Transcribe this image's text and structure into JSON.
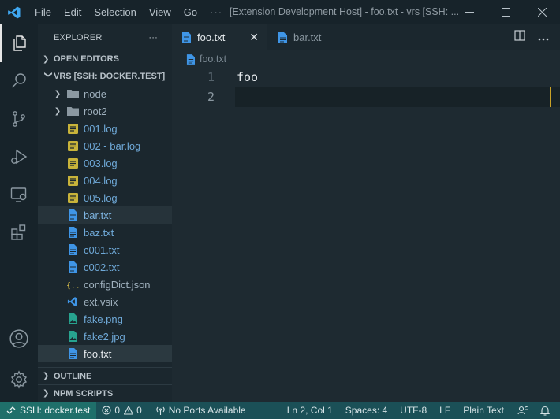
{
  "titlebar": {
    "menu": [
      "File",
      "Edit",
      "Selection",
      "View",
      "Go"
    ],
    "more": "···",
    "title": "[Extension Development Host] - foo.txt - vrs [SSH: ...",
    "brand_color": "#3fa7f0"
  },
  "activitybar": {
    "items": [
      "explorer-icon",
      "search-icon",
      "source-control-icon",
      "run-debug-icon",
      "remote-explorer-icon",
      "extensions-icon",
      "accounts-icon",
      "manage-gear-icon"
    ]
  },
  "sidebar": {
    "header": "EXPLORER",
    "header_more": "···",
    "open_editors": "OPEN EDITORS",
    "workspace": "VRS [SSH: DOCKER.TEST]",
    "items": [
      {
        "label": "node",
        "kind": "folder"
      },
      {
        "label": "root2",
        "kind": "folder"
      },
      {
        "label": "001.log",
        "kind": "log"
      },
      {
        "label": "002 - bar.log",
        "kind": "log"
      },
      {
        "label": "003.log",
        "kind": "log"
      },
      {
        "label": "004.log",
        "kind": "log"
      },
      {
        "label": "005.log",
        "kind": "log"
      },
      {
        "label": "bar.txt",
        "kind": "txt"
      },
      {
        "label": "baz.txt",
        "kind": "txt"
      },
      {
        "label": "c001.txt",
        "kind": "txt"
      },
      {
        "label": "c002.txt",
        "kind": "txt"
      },
      {
        "label": "configDict.json",
        "kind": "json"
      },
      {
        "label": "ext.vsix",
        "kind": "vsix"
      },
      {
        "label": "fake.png",
        "kind": "image"
      },
      {
        "label": "fake2.jpg",
        "kind": "image"
      },
      {
        "label": "foo.txt",
        "kind": "txt"
      }
    ],
    "outline": "OUTLINE",
    "npm_scripts": "NPM SCRIPTS"
  },
  "editor": {
    "tabs": [
      {
        "label": "foo.txt",
        "active": true,
        "close": "✕"
      },
      {
        "label": "bar.txt",
        "active": false
      }
    ],
    "breadcrumb": "foo.txt",
    "lines": [
      {
        "num": "1",
        "text": "foo"
      },
      {
        "num": "2",
        "text": ""
      }
    ]
  },
  "statusbar": {
    "remote": "SSH: docker.test",
    "errors": "0",
    "warnings": "0",
    "ports": "No Ports Available",
    "position": "Ln 2, Col 1",
    "spaces": "Spaces: 4",
    "encoding": "UTF-8",
    "eol": "LF",
    "language": "Plain Text"
  },
  "colors": {
    "accent": "#4aa3f5",
    "log_icon": "#c8b33a",
    "txt_icon": "#3f95e6",
    "json_icon": "#e6c84a",
    "image_icon": "#27a38f"
  }
}
